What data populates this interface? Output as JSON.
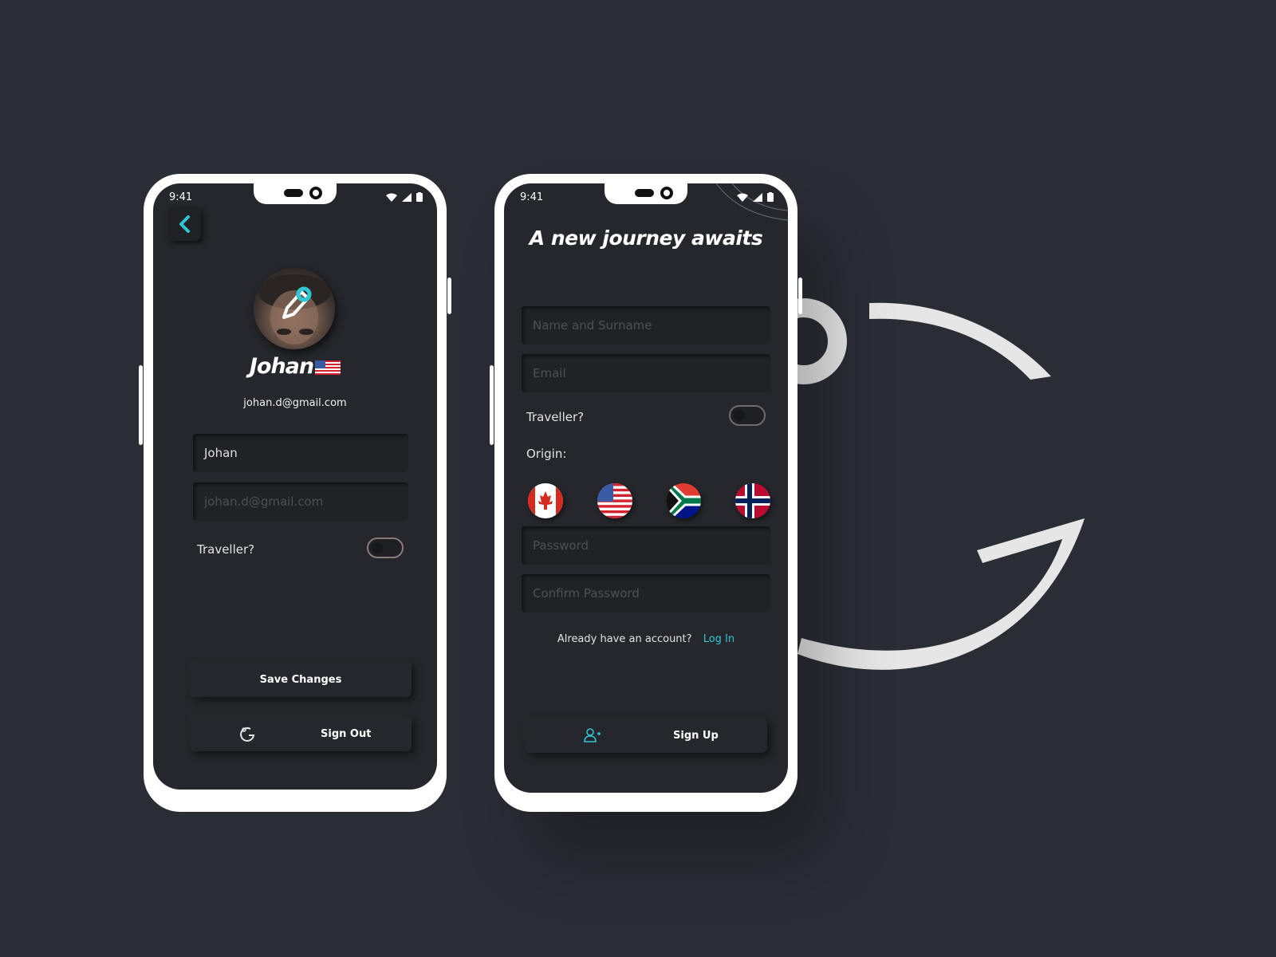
{
  "status": {
    "time": "9:41"
  },
  "profile_screen": {
    "name": "Johan",
    "email": "johan.d@gmail.com",
    "name_field_value": "Johan",
    "email_field_placeholder": "johan.d@gmail.com",
    "traveller_label": "Traveller?",
    "traveller_on": false,
    "save_label": "Save Changes",
    "sign_out_label": "Sign Out"
  },
  "signup_screen": {
    "title": "A new journey awaits",
    "name_placeholder": "Name and Surname",
    "email_placeholder": "Email",
    "traveller_label": "Traveller?",
    "traveller_on": false,
    "origin_label": "Origin:",
    "origin_flags": [
      "canada-flag-icon",
      "usa-flag-icon",
      "south-africa-flag-icon",
      "norway-flag-icon"
    ],
    "password_placeholder": "Password",
    "confirm_password_placeholder": "Confirm Password",
    "account_prompt": "Already have an account?",
    "login_link": "Log In",
    "sign_up_label": "Sign Up"
  },
  "colors": {
    "background": "#2a2d34",
    "screen": "#25272c",
    "accent": "#2fc6d6",
    "phone_frame": "#ffffff"
  }
}
